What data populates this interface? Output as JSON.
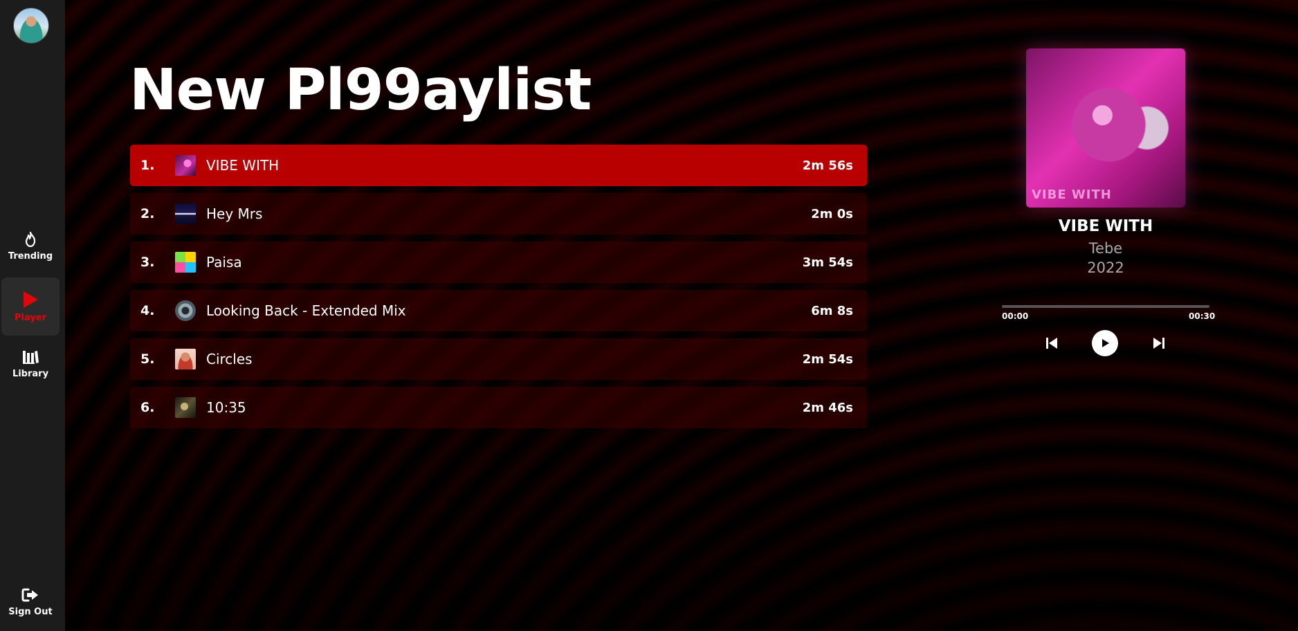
{
  "sidebar": {
    "items": [
      {
        "label": "Trending",
        "icon": "flame-icon"
      },
      {
        "label": "Player",
        "icon": "play-triangle-icon"
      },
      {
        "label": "Library",
        "icon": "library-icon"
      }
    ],
    "signout": {
      "label": "Sign Out",
      "icon": "sign-out-icon"
    },
    "active_color": "#e0070c"
  },
  "playlist": {
    "title": "New Pl99aylist",
    "tracks": [
      {
        "num": "1.",
        "title": "VIBE WITH",
        "duration": "2m 56s"
      },
      {
        "num": "2.",
        "title": "Hey Mrs",
        "duration": "2m 0s"
      },
      {
        "num": "3.",
        "title": "Paisa",
        "duration": "3m 54s"
      },
      {
        "num": "4.",
        "title": "Looking Back - Extended Mix",
        "duration": "6m 8s"
      },
      {
        "num": "5.",
        "title": "Circles",
        "duration": "2m 54s"
      },
      {
        "num": "6.",
        "title": "10:35",
        "duration": "2m 46s"
      }
    ],
    "active_color": "#b90000"
  },
  "now_playing": {
    "title": "VIBE WITH",
    "artist": "Tebe",
    "year": "2022",
    "cover_text": "VIBE WITH",
    "current_time": "00:00",
    "total_time": "00:30",
    "progress_fraction": 0
  }
}
